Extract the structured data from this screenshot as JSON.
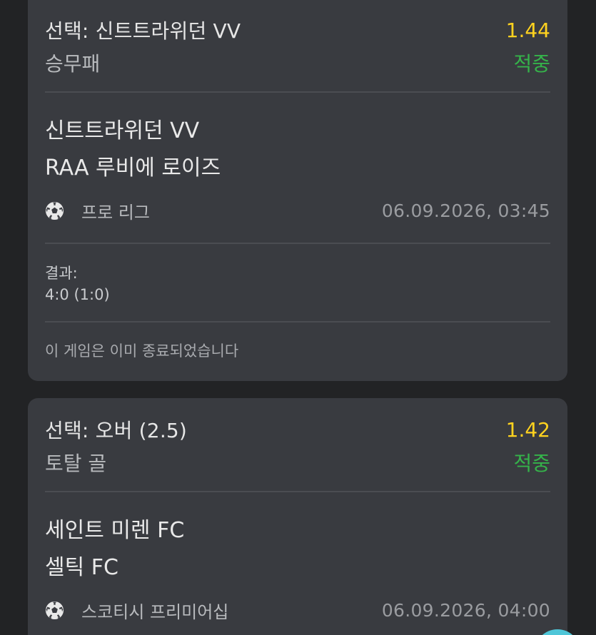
{
  "cards": [
    {
      "selection": "선택: 신트트라위던 VV",
      "odds": "1.44",
      "market": "승무패",
      "status": "적중",
      "home_team": "신트트라위던 VV",
      "away_team": "RAA 루비에 로이즈",
      "league_icon": "soccer-ball-icon",
      "league": "프로 리그",
      "datetime": "06.09.2026, 03:45",
      "result_label": "결과:",
      "result_value": "4:0 (1:0)",
      "note": "이 게임은 이미 종료되었습니다"
    },
    {
      "selection": "선택: 오버 (2.5)",
      "odds": "1.42",
      "market": "토탈 골",
      "status": "적중",
      "home_team": "세인트 미렌 FC",
      "away_team": "셀틱 FC",
      "league_icon": "soccer-ball-icon",
      "league": "스코티시 프리미어십",
      "datetime": "06.09.2026, 04:00"
    }
  ],
  "colors": {
    "background": "#222325",
    "card": "#393b40",
    "odds": "#ffd21f",
    "win_status": "#35b34a",
    "fab": "#4fc6d8"
  }
}
